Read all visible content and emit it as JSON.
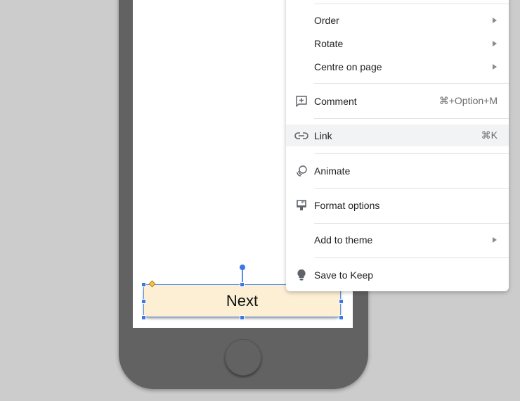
{
  "slide": {
    "button_shape_text": "Next",
    "button_fill": "#fcefd4",
    "phone_color": "#626262",
    "selection_color": "#3b78e7"
  },
  "context_menu": {
    "items": [
      {
        "label": "Order",
        "icon": null,
        "shortcut": null,
        "submenu": true
      },
      {
        "label": "Rotate",
        "icon": null,
        "shortcut": null,
        "submenu": true
      },
      {
        "label": "Centre on page",
        "icon": null,
        "shortcut": null,
        "submenu": true
      },
      {
        "label": "Comment",
        "icon": "add-comment-icon",
        "shortcut": "⌘+Option+M",
        "submenu": false
      },
      {
        "label": "Link",
        "icon": "link-icon",
        "shortcut": "⌘K",
        "submenu": false,
        "highlighted": true
      },
      {
        "label": "Animate",
        "icon": "animate-icon",
        "shortcut": null,
        "submenu": false
      },
      {
        "label": "Format options",
        "icon": "format-options-icon",
        "shortcut": null,
        "submenu": false
      },
      {
        "label": "Add to theme",
        "icon": null,
        "shortcut": null,
        "submenu": true
      },
      {
        "label": "Save to Keep",
        "icon": "keep-bulb-icon",
        "shortcut": null,
        "submenu": false
      }
    ]
  }
}
